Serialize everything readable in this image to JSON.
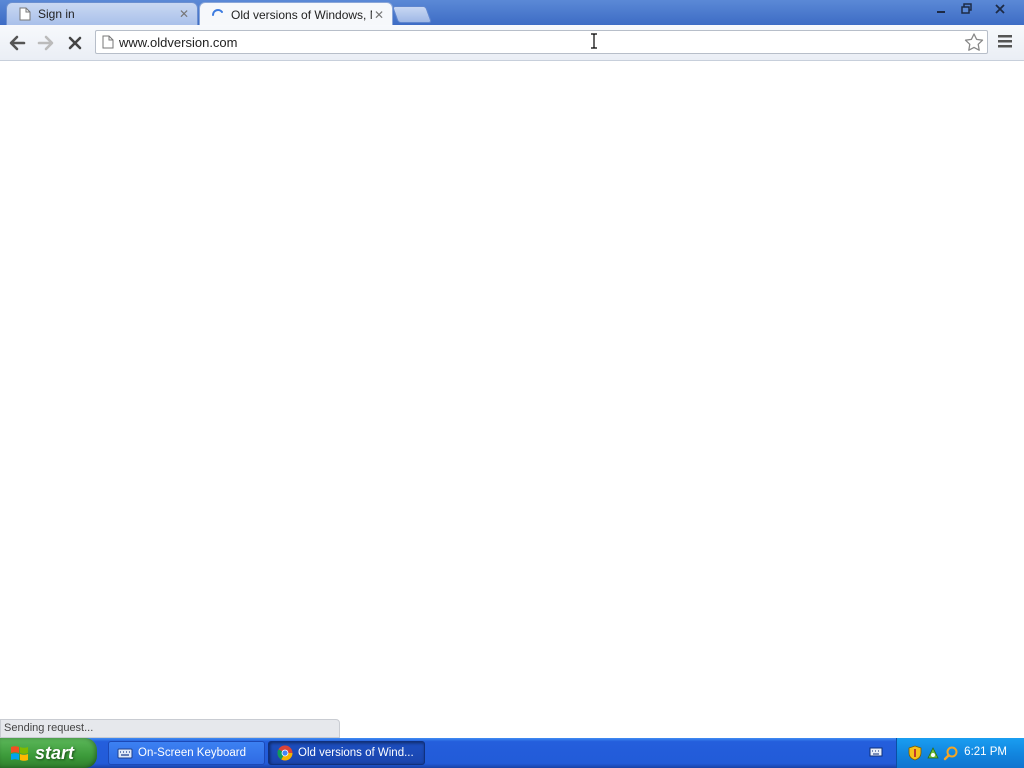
{
  "browser": {
    "tabs": [
      {
        "title": "Sign in",
        "active": false,
        "icon": "page-icon"
      },
      {
        "title": "Old versions of Windows, Mac",
        "active": true,
        "icon": "loading-spinner-icon"
      }
    ],
    "url": "www.oldversion.com",
    "status_text": "Sending request..."
  },
  "taskbar": {
    "start_label": "start",
    "buttons": [
      {
        "label": "On-Screen Keyboard",
        "icon": "keyboard-icon"
      },
      {
        "label": "Old versions of Wind...",
        "icon": "chrome-icon"
      }
    ],
    "clock": "6:21 PM"
  },
  "colors": {
    "titlebar": "#3d6cc5",
    "taskbar": "#245edc",
    "start": "#3c9a3a",
    "tray": "#1287e0"
  }
}
